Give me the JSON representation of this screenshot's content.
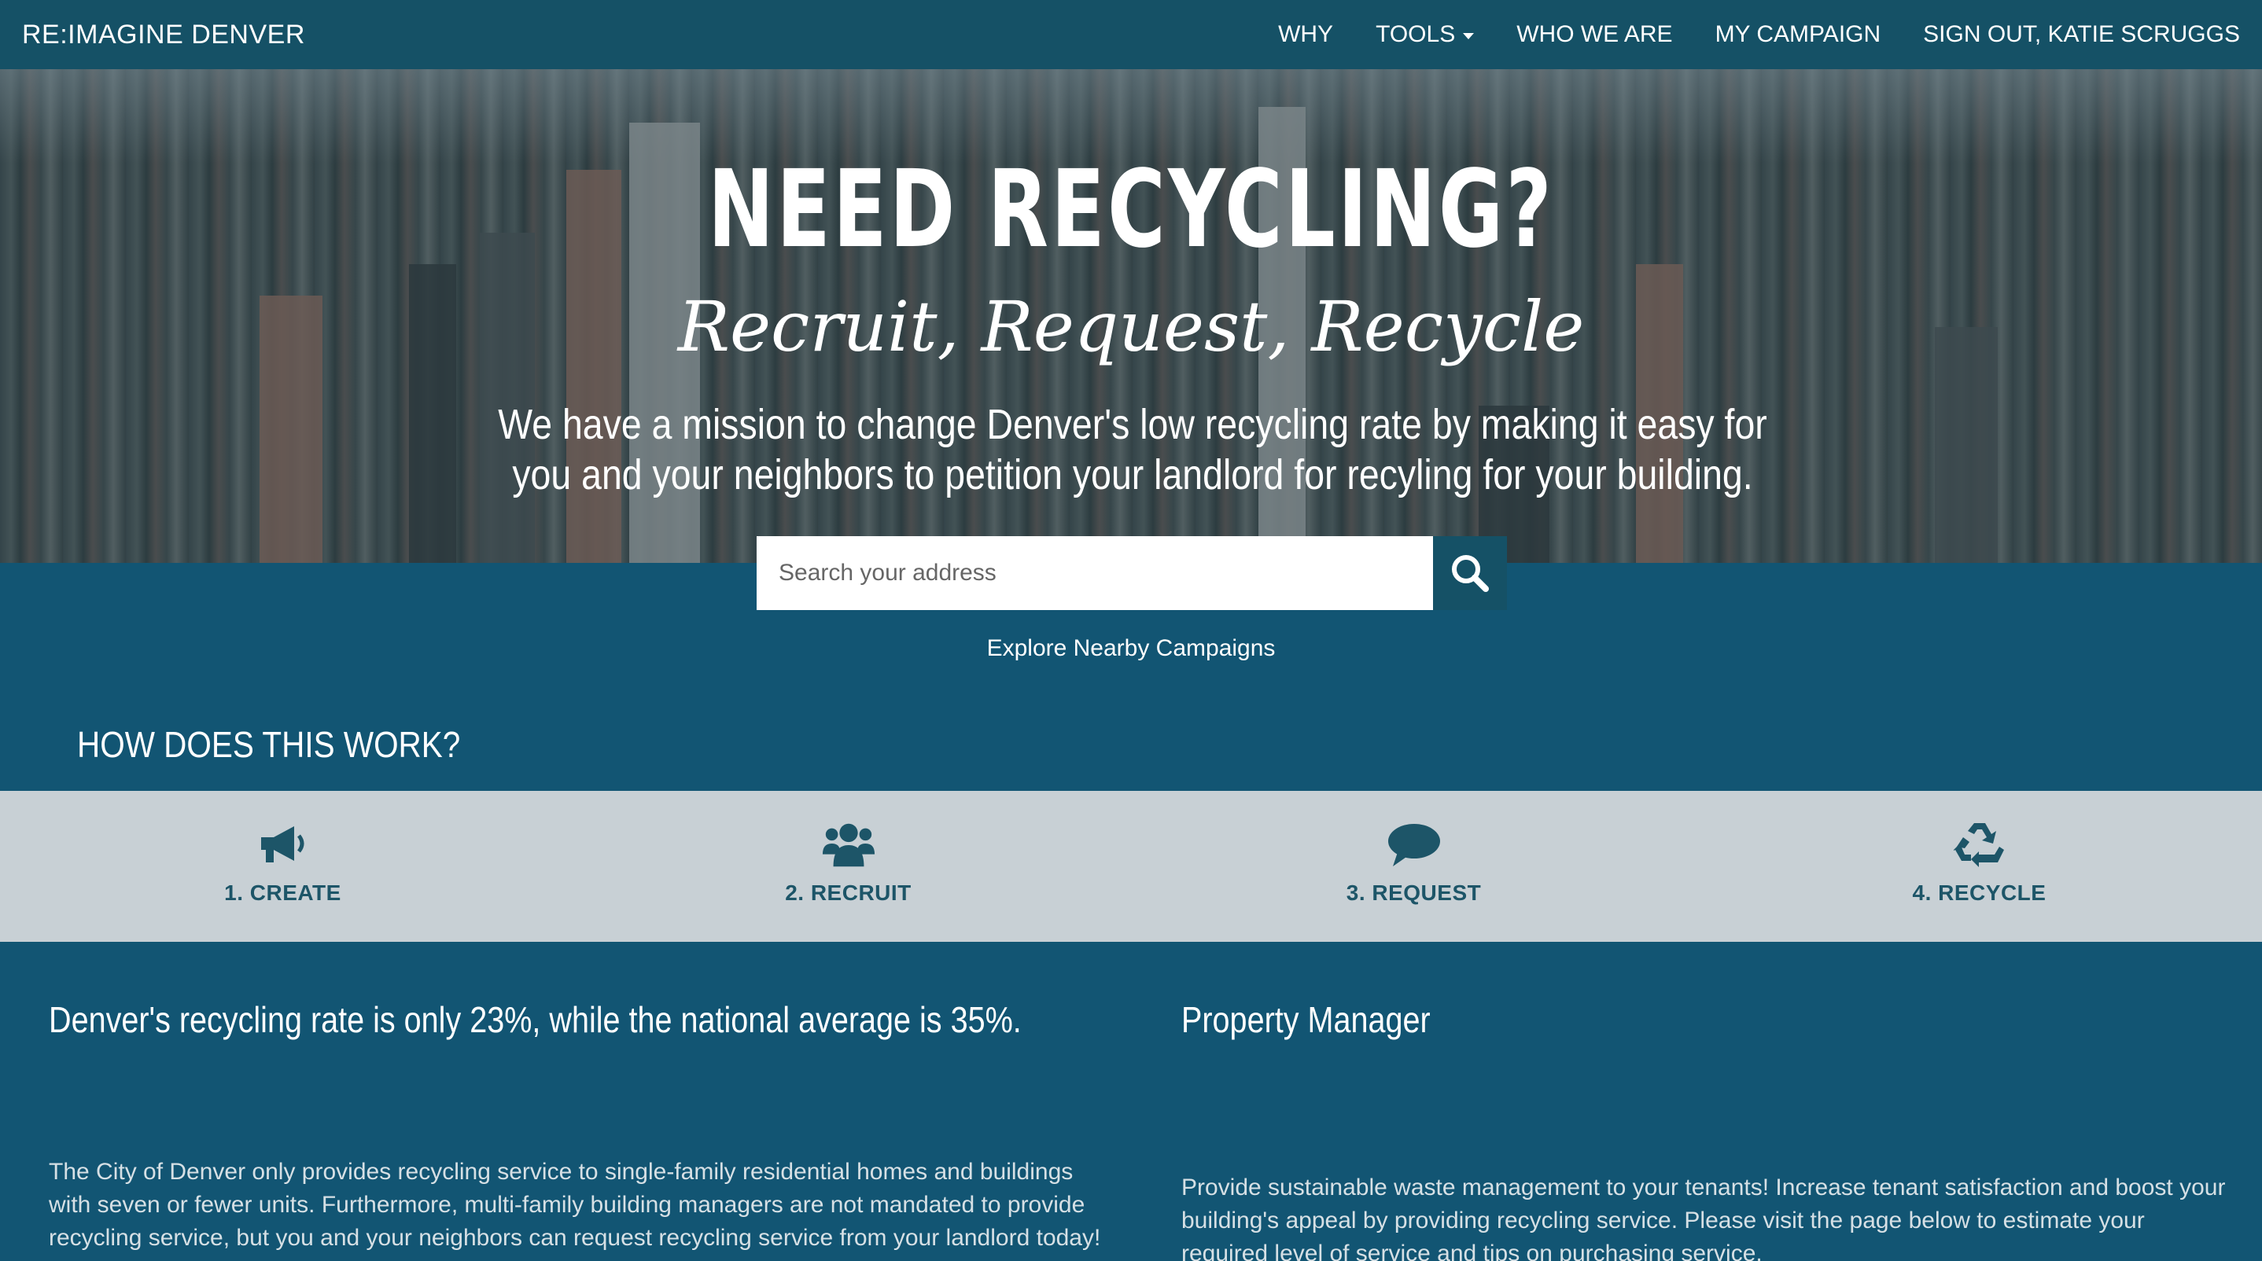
{
  "nav": {
    "brand": "RE:IMAGINE DENVER",
    "links": [
      "WHY",
      "TOOLS",
      "WHO WE ARE",
      "MY CAMPAIGN",
      "SIGN OUT, KATIE SCRUGGS"
    ]
  },
  "hero": {
    "title": "NEED RECYCLING?",
    "subtitle": "Recruit, Request, Recycle",
    "description": "We have a mission to change Denver's low recycling rate by making it easy for you and your neighbors to petition your landlord for recyling for your building."
  },
  "search": {
    "placeholder": "Search your address",
    "explore_link": "Explore Nearby Campaigns"
  },
  "how": {
    "heading": "HOW DOES THIS WORK?",
    "steps": [
      {
        "label": "1. CREATE",
        "icon": "megaphone-icon"
      },
      {
        "label": "2. RECRUIT",
        "icon": "users-icon"
      },
      {
        "label": "3. REQUEST",
        "icon": "speech-bubble-icon"
      },
      {
        "label": "4. RECYCLE",
        "icon": "recycle-icon"
      }
    ]
  },
  "info": {
    "left_heading": "Denver's recycling rate is only 23%, while the national average is 35%.",
    "left_text": "The City of Denver only provides recycling service to single-family residential homes and buildings with seven or fewer units. Furthermore, multi-family building managers are not mandated to provide recycling service, but you and your neighbors can request recycling service from your landlord today!",
    "right_heading": "Property Manager",
    "right_text": "Provide sustainable waste management to your tenants! Increase tenant satisfaction and boost your building's appeal by providing recycling service. Please visit the page below to estimate your required level of service and tips on purchasing service."
  },
  "colors": {
    "navbar": "#155166",
    "body": "#125573",
    "steps_band": "#c8d0d5",
    "step_text": "#1d5568"
  }
}
